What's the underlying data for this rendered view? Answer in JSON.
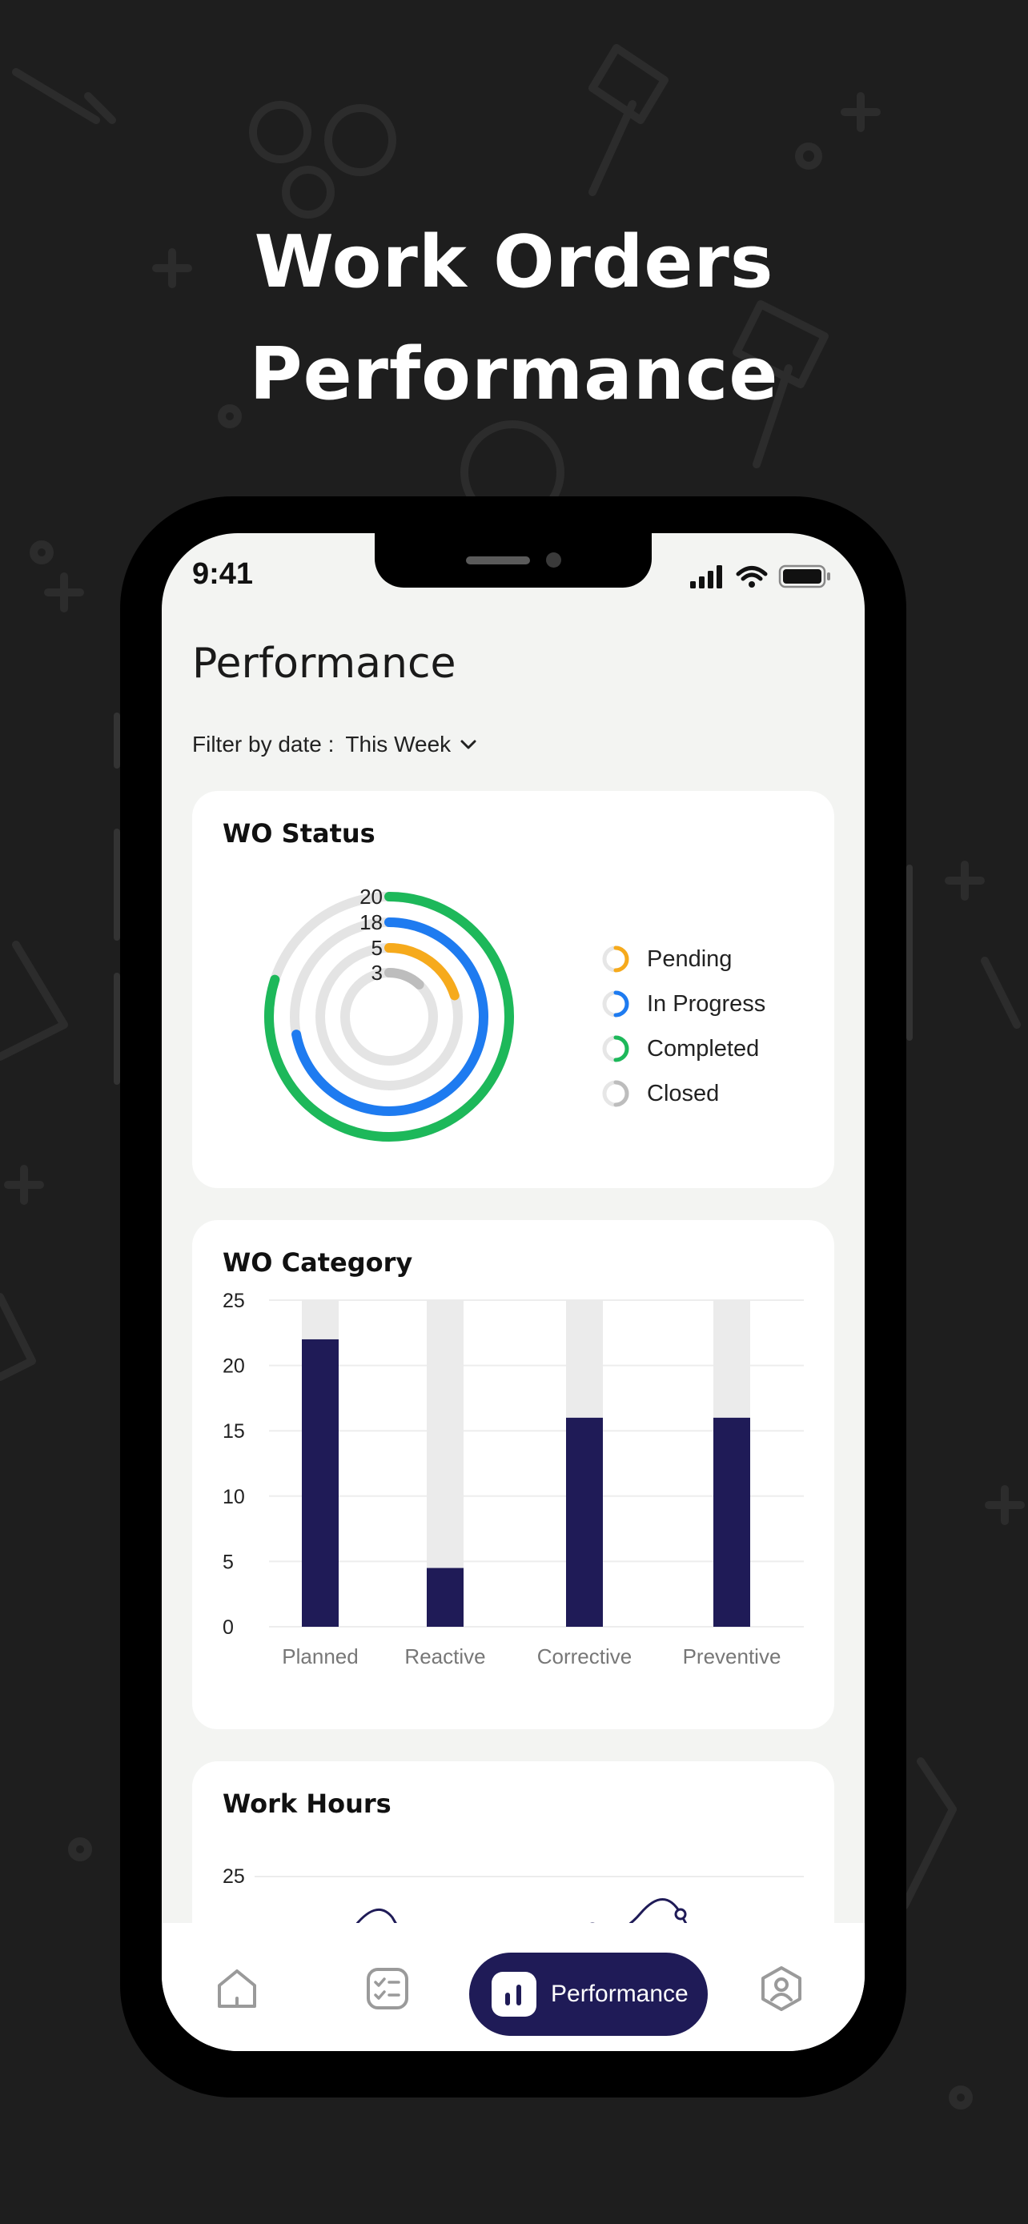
{
  "headline": {
    "line1": "Work Orders",
    "line2": "Performance"
  },
  "status_bar": {
    "time": "9:41"
  },
  "page": {
    "title": "Performance"
  },
  "filter": {
    "label": "Filter by date :",
    "value": "This Week"
  },
  "wo_status": {
    "title": "WO Status",
    "legend": [
      {
        "label": "Pending",
        "color": "#f6aa1c"
      },
      {
        "label": "In Progress",
        "color": "#1e7bf0"
      },
      {
        "label": "Completed",
        "color": "#1db85a"
      },
      {
        "label": "Closed",
        "color": "#bdbdbd"
      }
    ]
  },
  "wo_category": {
    "title": "WO Category"
  },
  "work_hours": {
    "title": "Work Hours"
  },
  "tabs": {
    "active_label": "Performance"
  },
  "icons": {
    "home": "home-icon",
    "tasks": "checklist-icon",
    "performance": "bar-chart-icon",
    "profile": "profile-icon",
    "chevron": "chevron-down-icon"
  },
  "colors": {
    "accent": "#1f1b57",
    "bar_track": "#ebebeb"
  },
  "chart_data": [
    {
      "type": "radial-bar",
      "title": "WO Status",
      "categories": [
        "Completed",
        "In Progress",
        "Pending",
        "Closed"
      ],
      "values": [
        20,
        18,
        5,
        3
      ],
      "colors": [
        "#1db85a",
        "#1e7bf0",
        "#f6aa1c",
        "#bdbdbd"
      ],
      "max": 25
    },
    {
      "type": "bar",
      "title": "WO Category",
      "categories": [
        "Planned",
        "Reactive",
        "Corrective",
        "Preventive"
      ],
      "values": [
        22,
        4.5,
        16,
        16
      ],
      "ylim": [
        0,
        25
      ],
      "yticks": [
        0,
        5,
        10,
        15,
        20,
        25
      ],
      "grid": true
    },
    {
      "type": "line",
      "title": "Work Hours",
      "yticks": [
        25
      ],
      "partially_visible": true
    }
  ]
}
